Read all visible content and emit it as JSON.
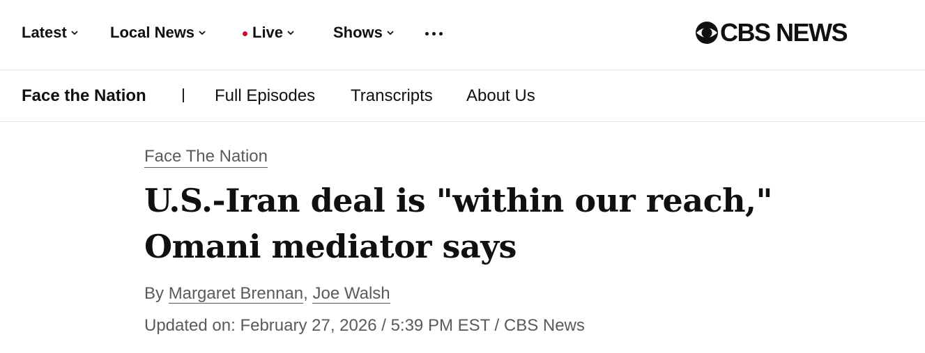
{
  "top_nav": {
    "items": [
      {
        "label": "Latest",
        "icon": "chevron-down-icon"
      },
      {
        "label": "Local News",
        "icon": "chevron-down-icon"
      },
      {
        "label": "Live",
        "icon": "chevron-down-icon",
        "indicator_color": "#c8102e"
      },
      {
        "label": "Shows",
        "icon": "chevron-down-icon"
      }
    ],
    "more_icon": "more-horizontal-icon",
    "logo_text": "CBS NEWS",
    "logo_icon": "cbs-eye-icon"
  },
  "sub_nav": {
    "title": "Face the Nation",
    "links": [
      "Full Episodes",
      "Transcripts",
      "About Us"
    ]
  },
  "article": {
    "kicker": "Face The Nation",
    "headline": "U.S.-Iran deal is \"within our reach,\" Omani mediator says",
    "byline_prefix": "By ",
    "authors": [
      "Margaret Brennan",
      "Joe Walsh"
    ],
    "author_separator": ", ",
    "updated": "Updated on: February 27, 2026 / 5:39 PM EST / CBS News"
  },
  "colors": {
    "text": "#101010",
    "muted": "#5a5a5a",
    "live": "#c8102e",
    "divider": "#e6e6e6"
  }
}
